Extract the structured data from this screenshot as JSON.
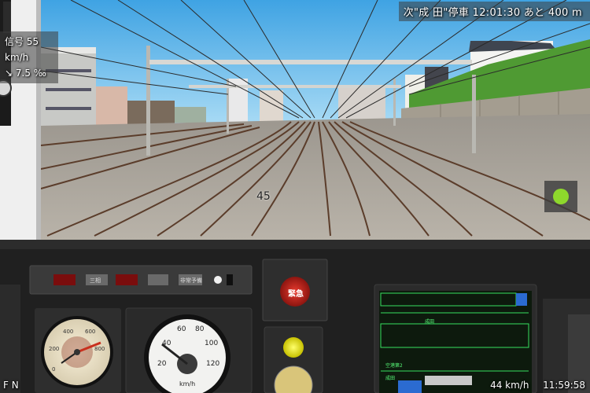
{
  "hud": {
    "next_stop": "次\"成 田\"停車 12:01:30 あと 400 m",
    "signal": "信号 55 km/h",
    "gradient": "↘ 7.5 ‰",
    "km_post": "45",
    "left_indicator": "F N",
    "speed": "44 km/h",
    "clock": "11:59:58"
  },
  "dashboard": {
    "emergency_label": "緊急",
    "panel_labels": [
      "三相",
      "非常予備"
    ],
    "speedometer_unit": "km/h",
    "speedometer_ticks": [
      "20",
      "40",
      "60",
      "80",
      "100",
      "120"
    ],
    "gauge_ticks": [
      "0",
      "200",
      "400",
      "600",
      "800"
    ]
  },
  "monitor": {
    "station_tag": "成田",
    "text_rows": [
      "空港第2",
      "成田"
    ]
  },
  "colors": {
    "sky": "#78c4ee",
    "ballast": "#a8a29a",
    "dash": "#2a2a2a",
    "monitor_green": "#38e060",
    "emergency_red": "#c8201a",
    "lamp_yellow": "#f2f20a"
  }
}
